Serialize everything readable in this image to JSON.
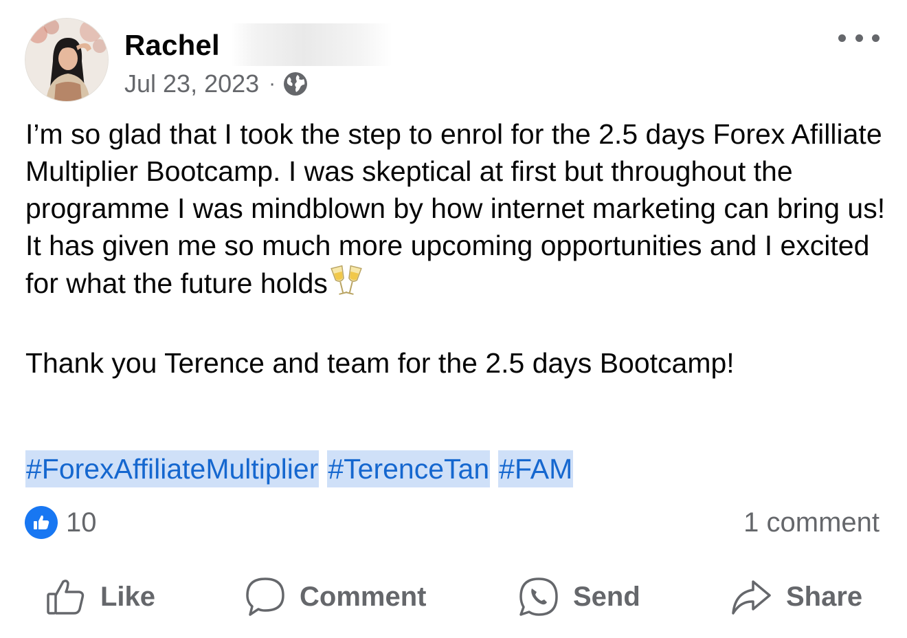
{
  "post": {
    "author": "Rachel",
    "date": "Jul 23, 2023",
    "separator": "·",
    "privacy_icon": "globe-icon",
    "more_icon": "more-options-icon",
    "body_paragraph_1": "I’m so glad that I took the step to enrol for the 2.5 days Forex Afilliate Multiplier Bootcamp. I was skeptical at first but throughout the programme I was mindblown by how internet marketing can bring us! It has given me so much more upcoming opportunities and I excited for what the future holds",
    "body_emoji": "clinking-glasses-emoji",
    "body_paragraph_2": "Thank you Terence and team for the 2.5 days Bootcamp!",
    "hashtags": [
      "#ForexAffiliateMultiplier",
      "#TerenceTan",
      "#FAM"
    ]
  },
  "engagement": {
    "reaction_icon": "thumbs-up-icon",
    "reaction_count": "10",
    "comment_count": "1 comment"
  },
  "actions": {
    "like": "Like",
    "comment": "Comment",
    "send": "Send",
    "share": "Share"
  },
  "colors": {
    "accent": "#1877f2",
    "hashtag_text": "#1567cf",
    "hashtag_highlight": "#cfe0f8",
    "secondary_text": "#65676b"
  }
}
